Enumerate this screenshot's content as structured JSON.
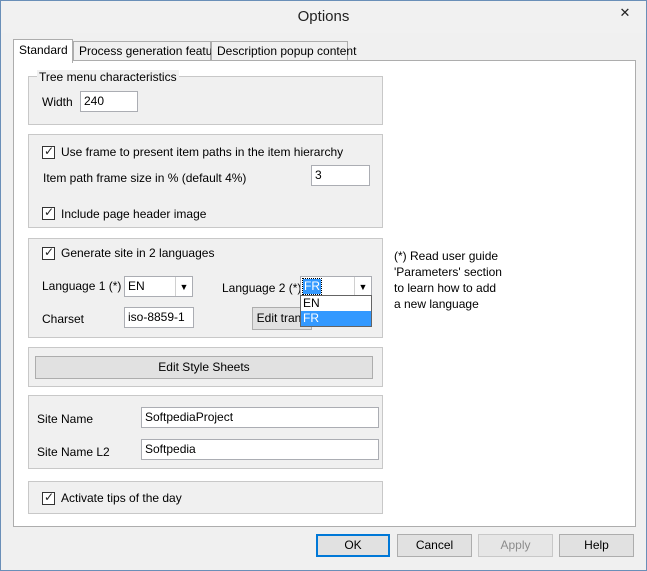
{
  "window": {
    "title": "Options",
    "close_glyph": "✕"
  },
  "tabs": [
    {
      "label": "Standard",
      "active": true
    },
    {
      "label": "Process generation feature",
      "active": false
    },
    {
      "label": "Description popup content",
      "active": false
    }
  ],
  "tree_menu": {
    "title": "Tree menu characteristics",
    "width_label": "Width",
    "width_value": "240"
  },
  "frame_group": {
    "use_frame_label": "Use frame to present item paths in the item hierarchy",
    "use_frame_checked": true,
    "frame_size_label": "Item path frame size in % (default 4%)",
    "frame_size_value": "3",
    "header_image_label": "Include page header image",
    "header_image_checked": true
  },
  "language_group": {
    "generate_label": "Generate site in 2 languages",
    "generate_checked": true,
    "language1_label": "Language 1 (*)",
    "language1_value": "EN",
    "language2_label": "Language 2 (*)",
    "language2_value": "FR",
    "language2_options": [
      "EN",
      "FR"
    ],
    "charset_label": "Charset",
    "charset_value": "iso-8859-1",
    "edit_trans_label": "Edit trans"
  },
  "note": {
    "line1": "(*) Read user guide",
    "line2": "'Parameters' section",
    "line3": "to learn how to add",
    "line4": "a new language"
  },
  "style_sheets": {
    "button_label": "Edit Style Sheets"
  },
  "site_names": {
    "site_name_label": "Site Name",
    "site_name_value": "SoftpediaProject",
    "site_name_l2_label": "Site Name L2",
    "site_name_l2_value": "Softpedia"
  },
  "tips": {
    "label": "Activate tips of the day",
    "checked": true
  },
  "footer": {
    "ok": "OK",
    "cancel": "Cancel",
    "apply": "Apply",
    "help": "Help"
  }
}
